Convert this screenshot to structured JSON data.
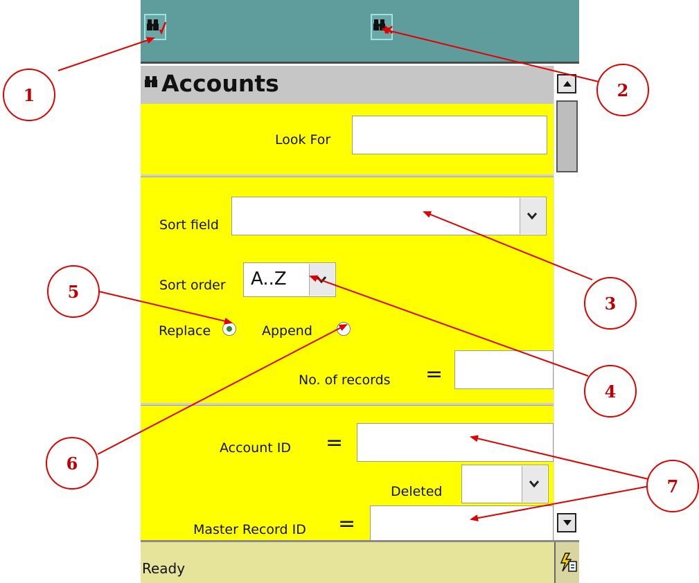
{
  "form": {
    "title": "Accounts",
    "look_for_label": "Look For",
    "look_for_value": "",
    "sort_field_label": "Sort field",
    "sort_field_value": "",
    "sort_order_label": "Sort order",
    "sort_order_value": "A..Z",
    "replace_label": "Replace",
    "append_label": "Append",
    "selected_mode": "Replace",
    "num_records_label": "No. of records",
    "num_records_value": "",
    "account_id_label": "Account ID",
    "account_id_value": "",
    "deleted_label": "Deleted",
    "deleted_value": "",
    "master_record_label": "Master Record ID",
    "master_record_value": "",
    "equals": "="
  },
  "status": {
    "text": "Ready"
  },
  "icons": {
    "apply_search": "binoculars-check-icon",
    "cancel_search": "binoculars-cross-icon",
    "title": "binoculars-icon",
    "sync": "sync-status-icon",
    "dropdown": "chevron-down-icon",
    "scroll_up": "scroll-up-icon",
    "scroll_down": "scroll-down-icon"
  },
  "colors": {
    "toolbar": "#5f9c9c",
    "form_background": "#ffff00",
    "title_bar": "#c6c6c6",
    "status_bar": "#e6e39a",
    "callout": "#e00000"
  },
  "callouts": [
    "1",
    "2",
    "3",
    "4",
    "5",
    "6",
    "7"
  ]
}
